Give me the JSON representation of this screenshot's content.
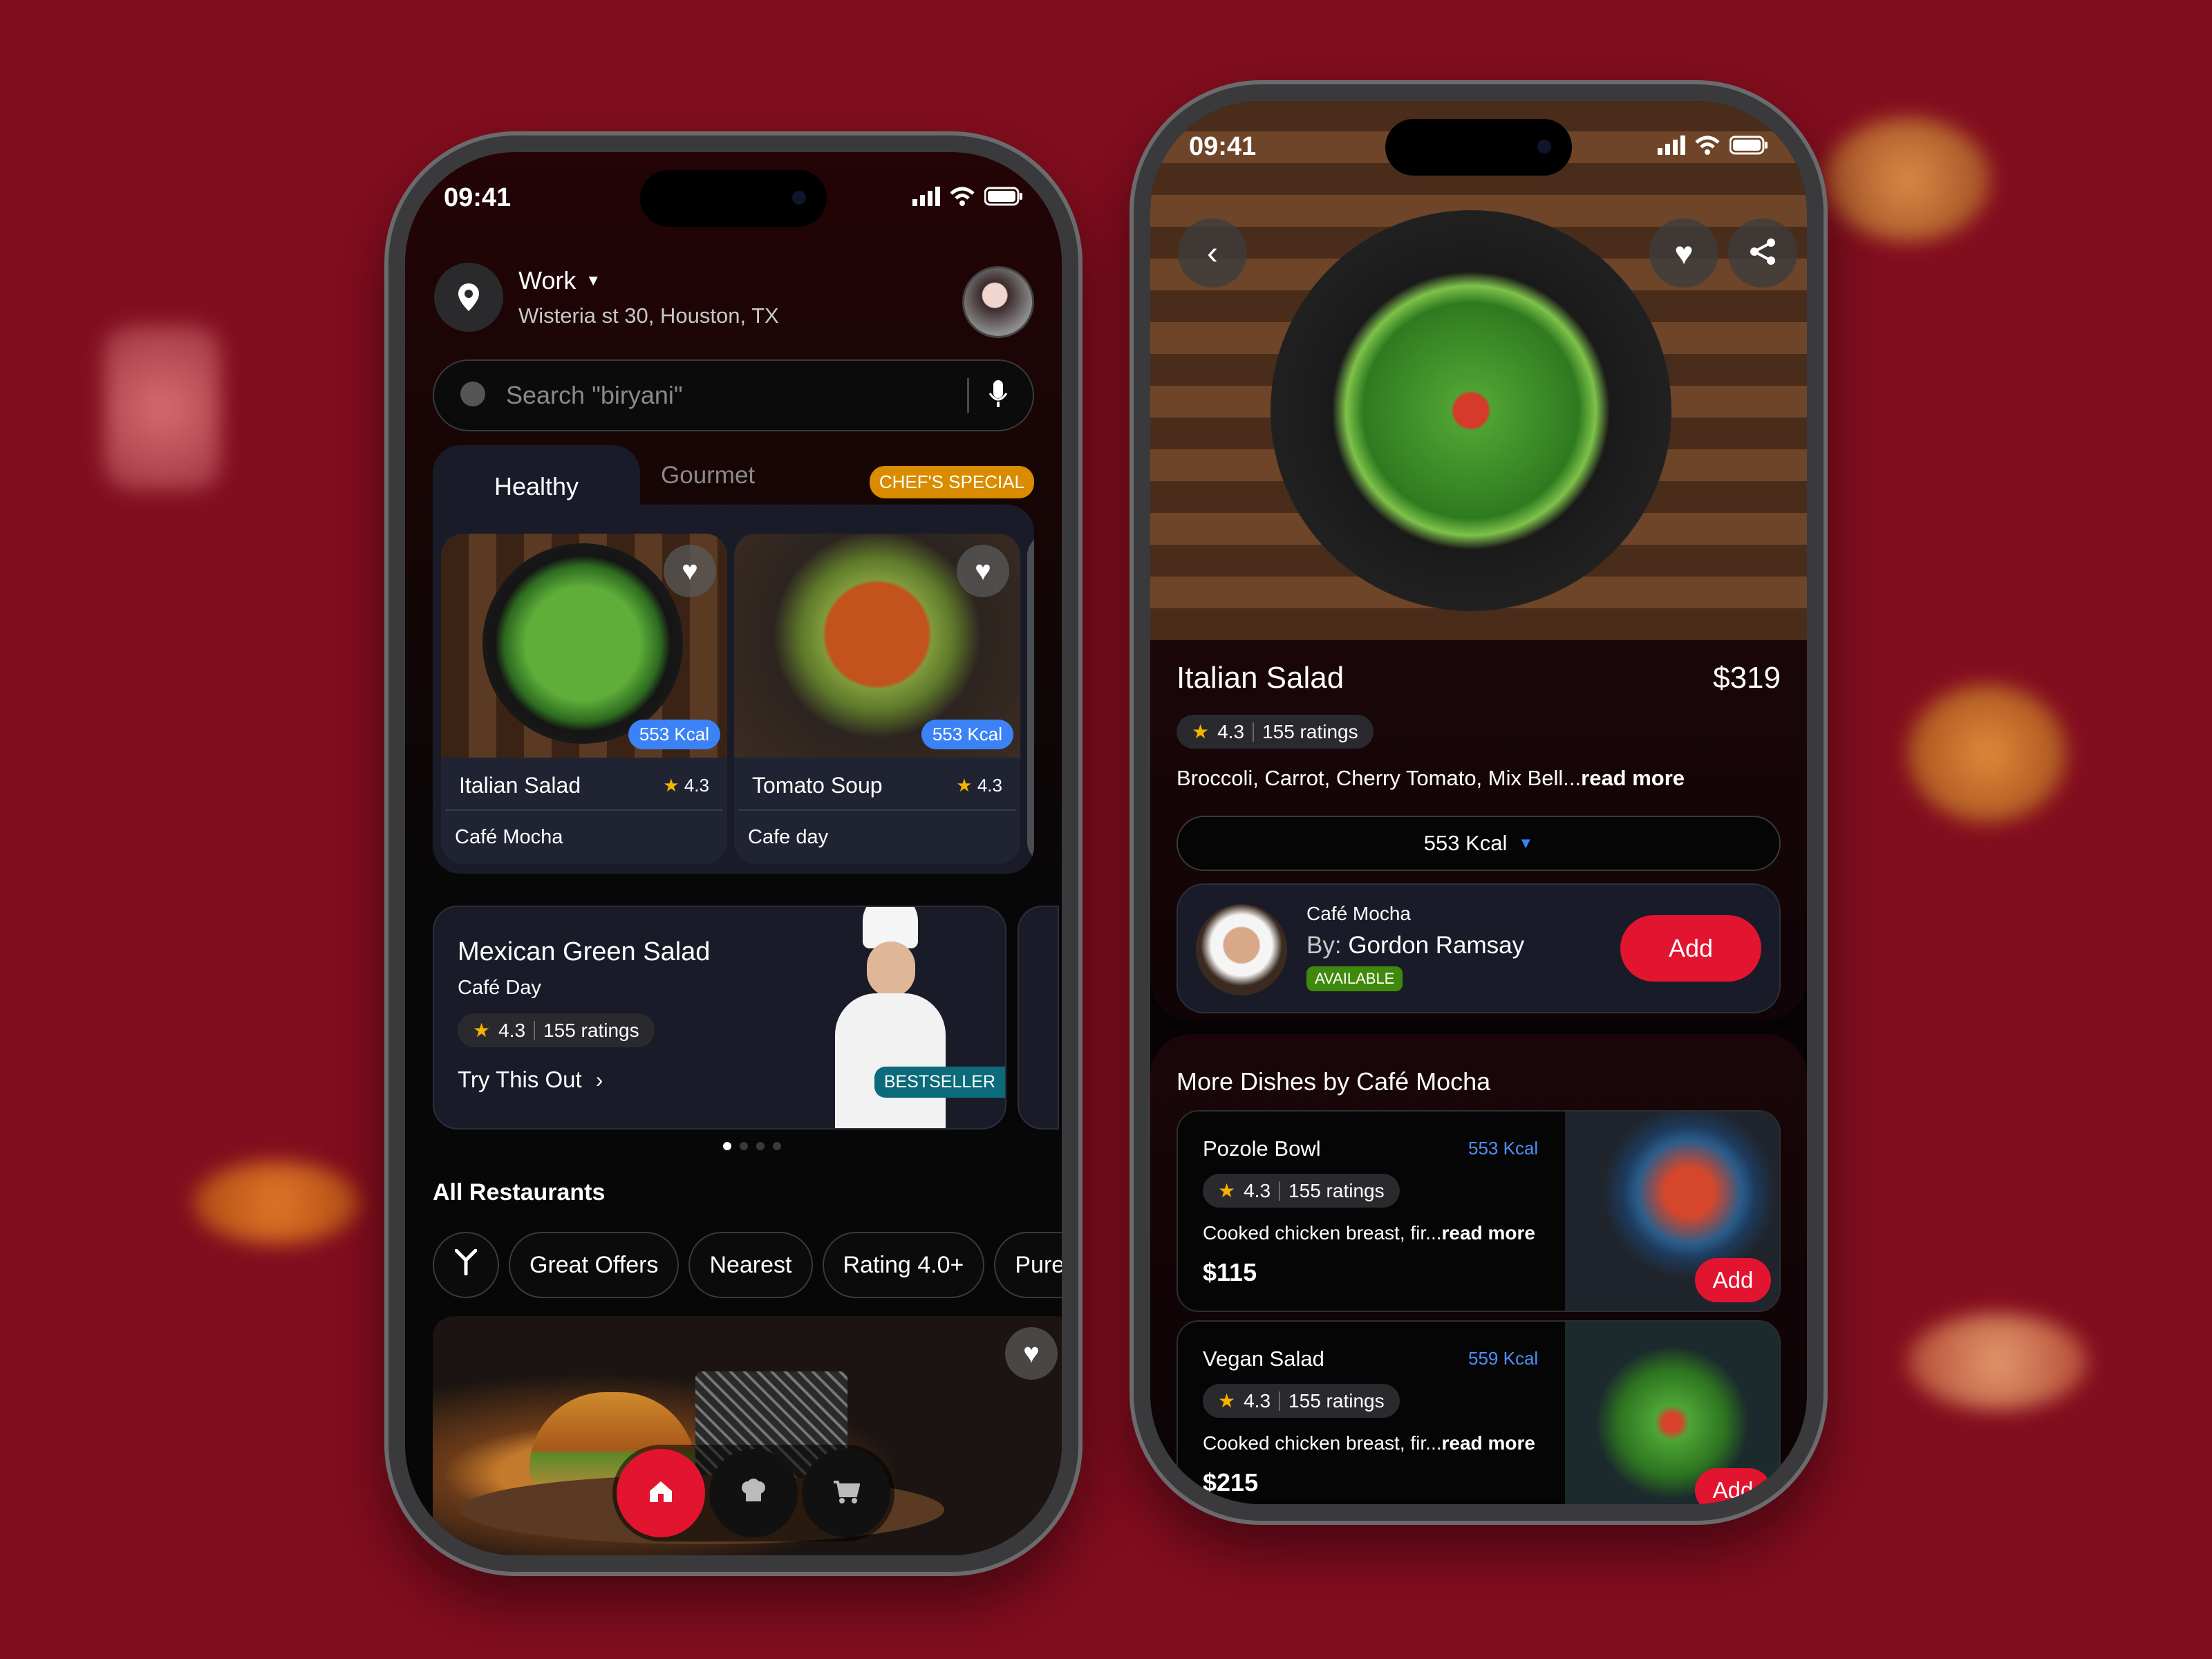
{
  "left": {
    "status_time": "09:41",
    "location": {
      "label": "Work",
      "address": "Wisteria st 30, Houston, TX"
    },
    "search": {
      "placeholder": "Search \"biryani\""
    },
    "tabs": {
      "active": "Healthy",
      "inactive": "Gourmet",
      "badge": "CHEF'S SPECIAL"
    },
    "cards": [
      {
        "name": "Italian Salad",
        "rating": "4.3",
        "place": "Café Mocha",
        "kcal": "553 Kcal"
      },
      {
        "name": "Tomato Soup",
        "rating": "4.3",
        "place": "Cafe day",
        "kcal": "553 Kcal"
      }
    ],
    "promo": {
      "title": "Mexican Green Salad",
      "place": "Café Day",
      "rating": "4.3",
      "ratings": "155 ratings",
      "cta": "Try This Out",
      "badge": "BESTSELLER"
    },
    "section_title": "All Restaurants",
    "filters": [
      "Great Offers",
      "Nearest",
      "Rating 4.0+",
      "Pure Ve"
    ]
  },
  "right": {
    "status_time": "09:41",
    "dish": {
      "name": "Italian Salad",
      "price": "$319",
      "rating": "4.3",
      "ratings": "155 ratings",
      "ingredients": "Broccoli, Carrot, Cherry Tomato, Mix Bell...",
      "read_more": "read more",
      "kcal": "553 Kcal"
    },
    "chef": {
      "cafe": "Café Mocha",
      "by_prefix": "By:",
      "name": "Gordon Ramsay",
      "status": "AVAILABLE",
      "add": "Add"
    },
    "more_title": "More Dishes by Café Mocha",
    "more": [
      {
        "name": "Pozole Bowl",
        "kcal": "553 Kcal",
        "rating": "4.3",
        "ratings": "155 ratings",
        "desc": "Cooked chicken breast, fir...",
        "read_more": "read more",
        "price": "$115",
        "add": "Add"
      },
      {
        "name": "Vegan Salad",
        "kcal": "559 Kcal",
        "rating": "4.3",
        "ratings": "155 ratings",
        "desc": "Cooked chicken breast, fir...",
        "read_more": "read more",
        "price": "$215",
        "add": "Add"
      }
    ]
  },
  "colors": {
    "background": "#820d1e",
    "accent_red": "#e3142f",
    "kcal_blue": "#3b82f6",
    "chef_special": "#d98c00",
    "bestseller": "#0b6b7a",
    "available": "#3f8a0c"
  }
}
